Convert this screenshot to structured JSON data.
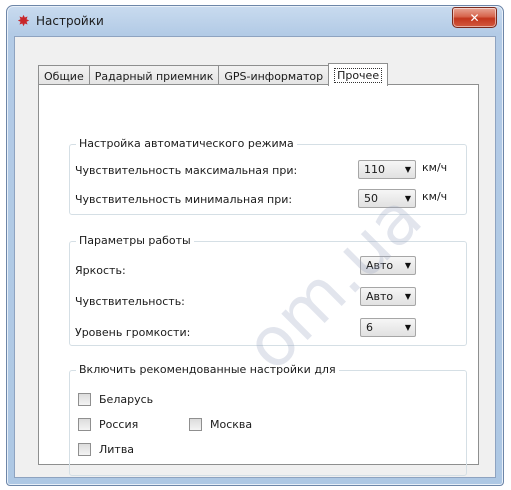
{
  "window": {
    "title": "Настройки",
    "close_glyph": "✕",
    "app_icon_glyph": "✸"
  },
  "tabs": [
    {
      "label": "Общие",
      "active": false
    },
    {
      "label": "Радарный приемник",
      "active": false
    },
    {
      "label": "GPS-информатор",
      "active": false
    },
    {
      "label": "Прочее",
      "active": true
    }
  ],
  "auto_mode": {
    "title": "Настройка автоматического режима",
    "max_label": "Чувствительность максимальная при:",
    "max_value": "110",
    "min_label": "Чувствительность минимальная при:",
    "min_value": "50",
    "unit": "км/ч"
  },
  "params": {
    "title": "Параметры работы",
    "brightness_label": "Яркость:",
    "brightness_value": "Авто",
    "sensitivity_label": "Чувствительность:",
    "sensitivity_value": "Авто",
    "volume_label": "Уровень громкости:",
    "volume_value": "6"
  },
  "recommended": {
    "title": "Включить рекомендованные настройки для",
    "belarus": "Беларусь",
    "russia": "Россия",
    "moscow": "Москва",
    "lithuania": "Литва"
  },
  "watermark": "om.ua",
  "dropdown_arrow": "▼"
}
